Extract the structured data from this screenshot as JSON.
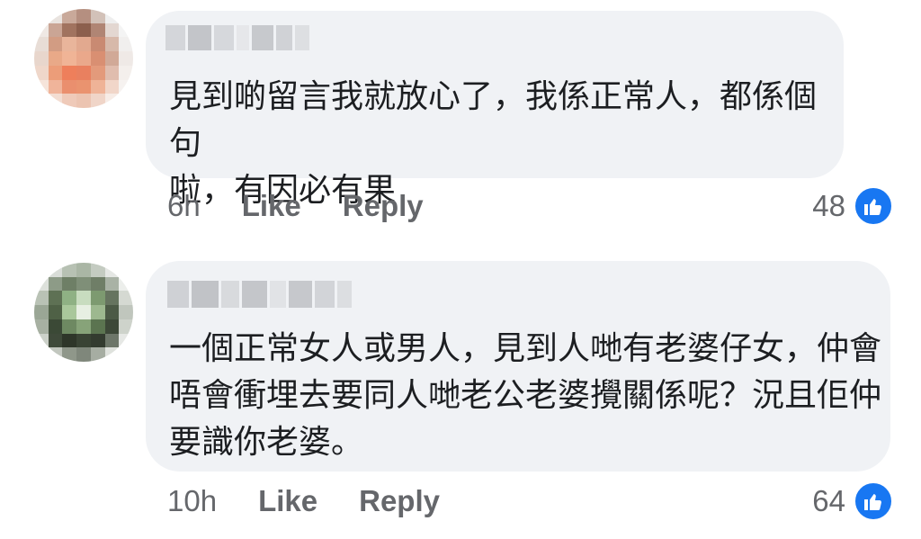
{
  "comments": [
    {
      "text": "見到啲留言我就放心了，我係正常人，都係個句\n啦，有因必有果",
      "time": "6h",
      "like_label": "Like",
      "reply_label": "Reply",
      "reaction_count": "48",
      "reaction_icon": "thumbs-up-icon"
    },
    {
      "text": "一個正常女人或男人，見到人哋有老婆仔女，仲會\n唔會衝埋去要同人哋老公老婆攪關係呢？況且佢仲\n要識你老婆。",
      "time": "10h",
      "like_label": "Like",
      "reply_label": "Reply",
      "reaction_count": "64",
      "reaction_icon": "thumbs-up-icon"
    }
  ],
  "colors": {
    "bubble": "#f0f2f5",
    "text": "#1c1e21",
    "meta": "#65676b",
    "like_blue": "#1877f2"
  }
}
